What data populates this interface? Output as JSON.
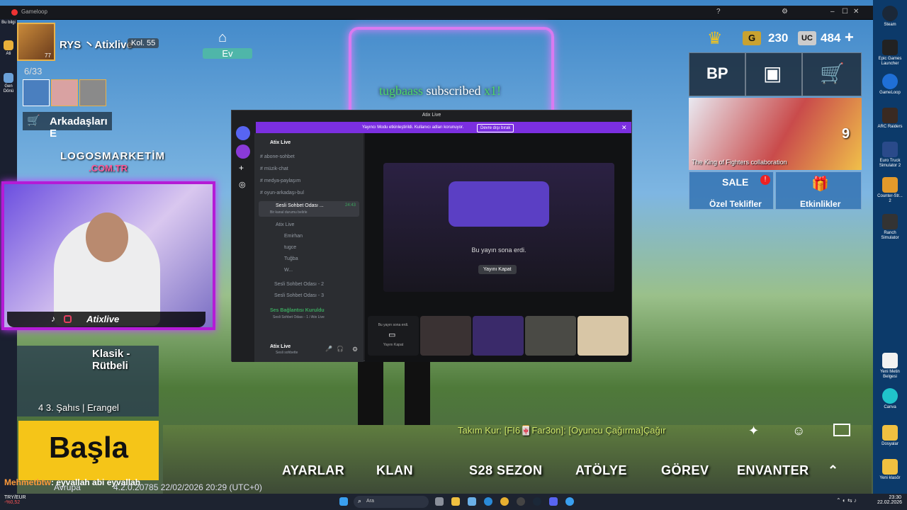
{
  "gameloop": {
    "title": "Gameloop"
  },
  "desktop_left": {
    "items": [
      "Bu bilgi",
      "Ati",
      "Gen Dönü"
    ]
  },
  "desktop_right": {
    "items": [
      "Steam",
      "Epic Games Launcher",
      "GameLoop",
      "ARC Raiders",
      "Euro Truck Simulator 2",
      "Counter-Str... 2",
      "Ranch Simulator",
      "Yeni Metin Belgesi",
      "Canva",
      "Dosyalar",
      "Yeni klasör"
    ]
  },
  "hud": {
    "player_name": "RYS 丶Atixlive",
    "level": "Kol. 55",
    "avatar_level": "77",
    "party_count": "6/33",
    "friends_label": "Arkadaşları E",
    "home_label": "Ev",
    "currency_g": "230",
    "currency_uc": "484",
    "banner_text": "The King of Fighters collaboration",
    "banner_count": "9",
    "special_offers": "Özel Teklifler",
    "events": "Etkinlikler",
    "mode_label": "Klasik - Rütbeli",
    "mode_detail": "4 3. Şahıs | Erangel",
    "start_button": "Başla",
    "team_message": "Takım Kur: [FI6🀄Far3on]: [Oyuncu Çağırma]Çağır",
    "region": "Avrupa",
    "version": "4.2.0.20785 22/02/2026 20:29 (UTC+0)",
    "bottom_tabs": [
      "AYARLAR",
      "KLAN",
      "S28 SEZON",
      "ATÖLYE",
      "GÖREV",
      "ENVANTER"
    ]
  },
  "overlay": {
    "logo_line1": "LOGOSMARKETİM",
    "logo_line2": ".COM.TR",
    "webcam_handle": "Atixlive",
    "subscribe_user": "tugbaass",
    "subscribe_text": "subscribed",
    "subscribe_x": "x1!",
    "chat_user": "Mehmetbtw",
    "chat_text": ": eyvallah abi eyvallah"
  },
  "discord": {
    "title": "Atix Live",
    "banner": "Yayıncı Modu etkinleştirildi. Kullanıcı adları korunuyor.",
    "banner_button": "Devre dışı bırak",
    "server_name": "Atix Live",
    "channels": [
      "abone-sohbet",
      "müzik-chat",
      "medya-paylaşım",
      "oyun-arkadaşı-bul"
    ],
    "voice_channel": "Sesli Sohbet Odası ...",
    "voice_timer": "24:43",
    "voice_status": "Bir kanal durumu belirle",
    "voice_users": [
      "Atix Live",
      "Emirhan",
      "tugce",
      "Tuğba",
      "W..."
    ],
    "other_voice": [
      "Sesli Sohbet Odası - 2",
      "Sesli Sohbet Odası - 3"
    ],
    "connection_title": "Ses Bağlantısı Kuruldu",
    "connection_sub": "Sesli Sohbet Odası - 1 / Atix Live",
    "user_name": "Atix Live",
    "user_status": "Sesli sohbette",
    "stream_ended": "Bu yayın sona erdi.",
    "close_stream": "Yayını Kapat",
    "tile_ended": "Bu yayın sona erdi.",
    "tile_close": "Yayını Kapat"
  },
  "taskbar": {
    "currency": "TRY/EUR",
    "currency_change": "-%0,52",
    "search": "Ara",
    "time": "23:30",
    "date": "22.02.2026"
  }
}
